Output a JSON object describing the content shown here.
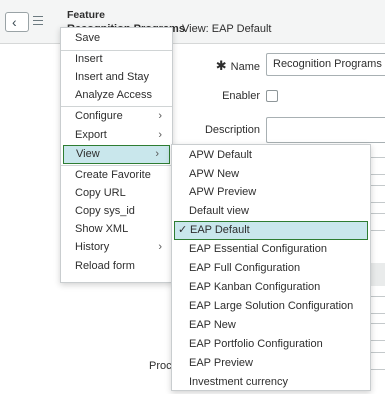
{
  "header": {
    "form_type": "Feature",
    "form_title_clip": "Recognition Programs",
    "view_label": "View: EAP Default"
  },
  "form": {
    "name_label": "Name",
    "name_required_marker": "✱",
    "name_value": "Recognition Programs",
    "enabler_label": "Enabler",
    "enabler_checked": false,
    "description_label": "Description",
    "product_label_clip": "Proc"
  },
  "context_menu": {
    "items": [
      {
        "label": "Save"
      },
      {
        "label": "Insert"
      },
      {
        "label": "Insert and Stay"
      },
      {
        "label": "Analyze Access"
      },
      {
        "label": "Configure",
        "submenu": true
      },
      {
        "label": "Export",
        "submenu": true
      },
      {
        "label": "View",
        "submenu": true,
        "active": true
      },
      {
        "label": "Create Favorite"
      },
      {
        "label": "Copy URL"
      },
      {
        "label": "Copy sys_id"
      },
      {
        "label": "Show XML"
      },
      {
        "label": "History",
        "submenu": true
      },
      {
        "label": "Reload form"
      }
    ],
    "submenu_arrow": "›"
  },
  "view_submenu": {
    "check_glyph": "✓",
    "selected": "EAP Default",
    "items": [
      "APW Default",
      "APW New",
      "APW Preview",
      "Default view",
      "EAP Default",
      "EAP Essential Configuration",
      "EAP Full Configuration",
      "EAP Kanban Configuration",
      "EAP Large Solution Configuration",
      "EAP New",
      "EAP Portfolio Configuration",
      "EAP Preview",
      "Investment currency"
    ]
  },
  "colors": {
    "highlight_bg": "#c9e7ec",
    "highlight_border": "#2e7d32",
    "header_bg": "#f4f5f5"
  }
}
